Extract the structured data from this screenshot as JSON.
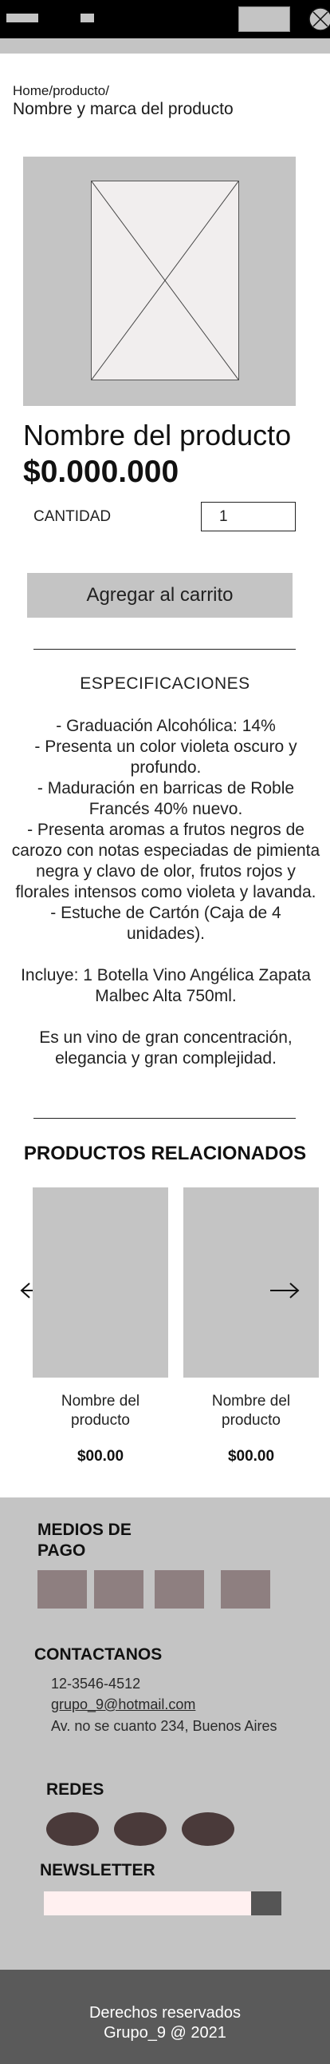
{
  "breadcrumb": {
    "path": "Home/producto/",
    "title": "Nombre y marca del producto"
  },
  "product": {
    "name": "Nombre del producto",
    "price": "$0.000.000",
    "quantity_label": "CANTIDAD",
    "quantity_value": "1",
    "add_to_cart": "Agregar al carrito"
  },
  "specs": {
    "title": "ESPECIFICACIONES",
    "items": [
      "- Graduación Alcohólica: 14%",
      "- Presenta un color violeta oscuro y profundo.",
      "- Maduración en barricas de Roble Francés 40% nuevo.",
      "- Presenta aromas a frutos negros de carozo con notas especiadas de pimienta negra y clavo de olor, frutos rojos y florales intensos como violeta y lavanda.",
      "- Estuche de Cartón (Caja de 4 unidades)."
    ],
    "includes": "Incluye: 1 Botella Vino Angélica Zapata Malbec Alta 750ml.",
    "description": "Es un vino de gran concentración, elegancia y gran complejidad."
  },
  "related": {
    "title": "PRODUCTOS RELACIONADOS",
    "items": [
      {
        "name": "Nombre del producto",
        "price": "$00.00"
      },
      {
        "name": "Nombre del producto",
        "price": "$00.00"
      }
    ]
  },
  "footer": {
    "payment_title": "MEDIOS DE PAGO",
    "contact_title": "CONTACTANOS",
    "phone": "12-3546-4512",
    "email": "grupo_9@hotmail.com",
    "address": "Av. no se cuanto 234, Buenos Aires",
    "social_title": "REDES",
    "newsletter_title": "NEWSLETTER",
    "copyright_line1": "Derechos reservados",
    "copyright_line2": "Grupo_9 @ 2021"
  },
  "icons": {
    "close": "close-circle-icon",
    "prev": "arrow-left-icon",
    "next": "arrow-right-icon",
    "image_placeholder": "image-placeholder-icon"
  },
  "colors": {
    "topbar": "#000000",
    "placeholder_gray": "#c4c4c4",
    "payment_tile": "#8e7f80",
    "social_circle": "#4a3a3a",
    "copyright_bg": "#5a5a5a"
  }
}
